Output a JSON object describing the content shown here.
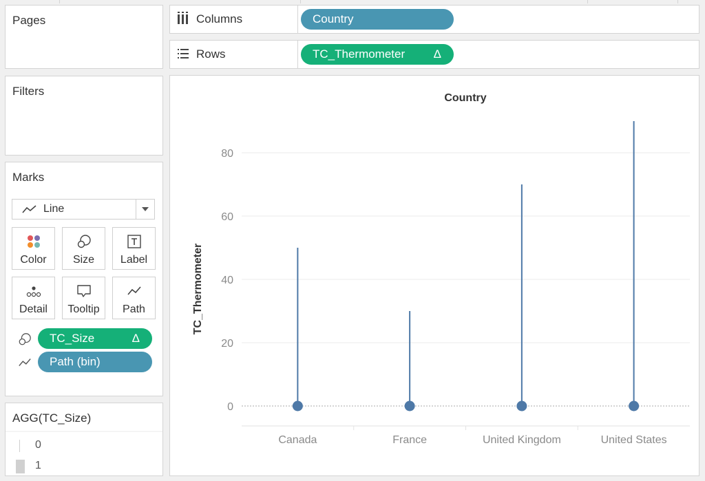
{
  "sidebar": {
    "pages_title": "Pages",
    "filters_title": "Filters",
    "marks": {
      "title": "Marks",
      "mark_type": "Line",
      "buttons": [
        {
          "label": "Color",
          "icon": "color-icon"
        },
        {
          "label": "Size",
          "icon": "size-icon"
        },
        {
          "label": "Label",
          "icon": "label-icon"
        },
        {
          "label": "Detail",
          "icon": "detail-icon"
        },
        {
          "label": "Tooltip",
          "icon": "tooltip-icon"
        },
        {
          "label": "Path",
          "icon": "path-icon"
        }
      ],
      "fields": [
        {
          "name": "TC_Size",
          "badge": "Δ",
          "role": "size-icon",
          "color": "#15b078"
        },
        {
          "name": "Path (bin)",
          "badge": "",
          "role": "path-icon",
          "color": "#4996b2"
        }
      ]
    },
    "legend": {
      "title": "AGG(TC_Size)",
      "items": [
        "0",
        "1"
      ]
    }
  },
  "shelves": {
    "columns": {
      "label": "Columns",
      "pill": "Country",
      "color": "#4996b2"
    },
    "rows": {
      "label": "Rows",
      "pill": "TC_Thermometer",
      "badge": "Δ",
      "color": "#15b078"
    }
  },
  "chart_data": {
    "type": "line",
    "title": "Country",
    "ylabel": "TC_Thermometer",
    "categories": [
      "Canada",
      "France",
      "United Kingdom",
      "United States"
    ],
    "values": [
      50,
      30,
      70,
      90
    ],
    "baseline": [
      0,
      0,
      0,
      0
    ],
    "ylim": [
      0,
      100
    ],
    "yticks": [
      0,
      20,
      40,
      60,
      80
    ],
    "mark_color": "#4e79a7",
    "grid": true
  }
}
